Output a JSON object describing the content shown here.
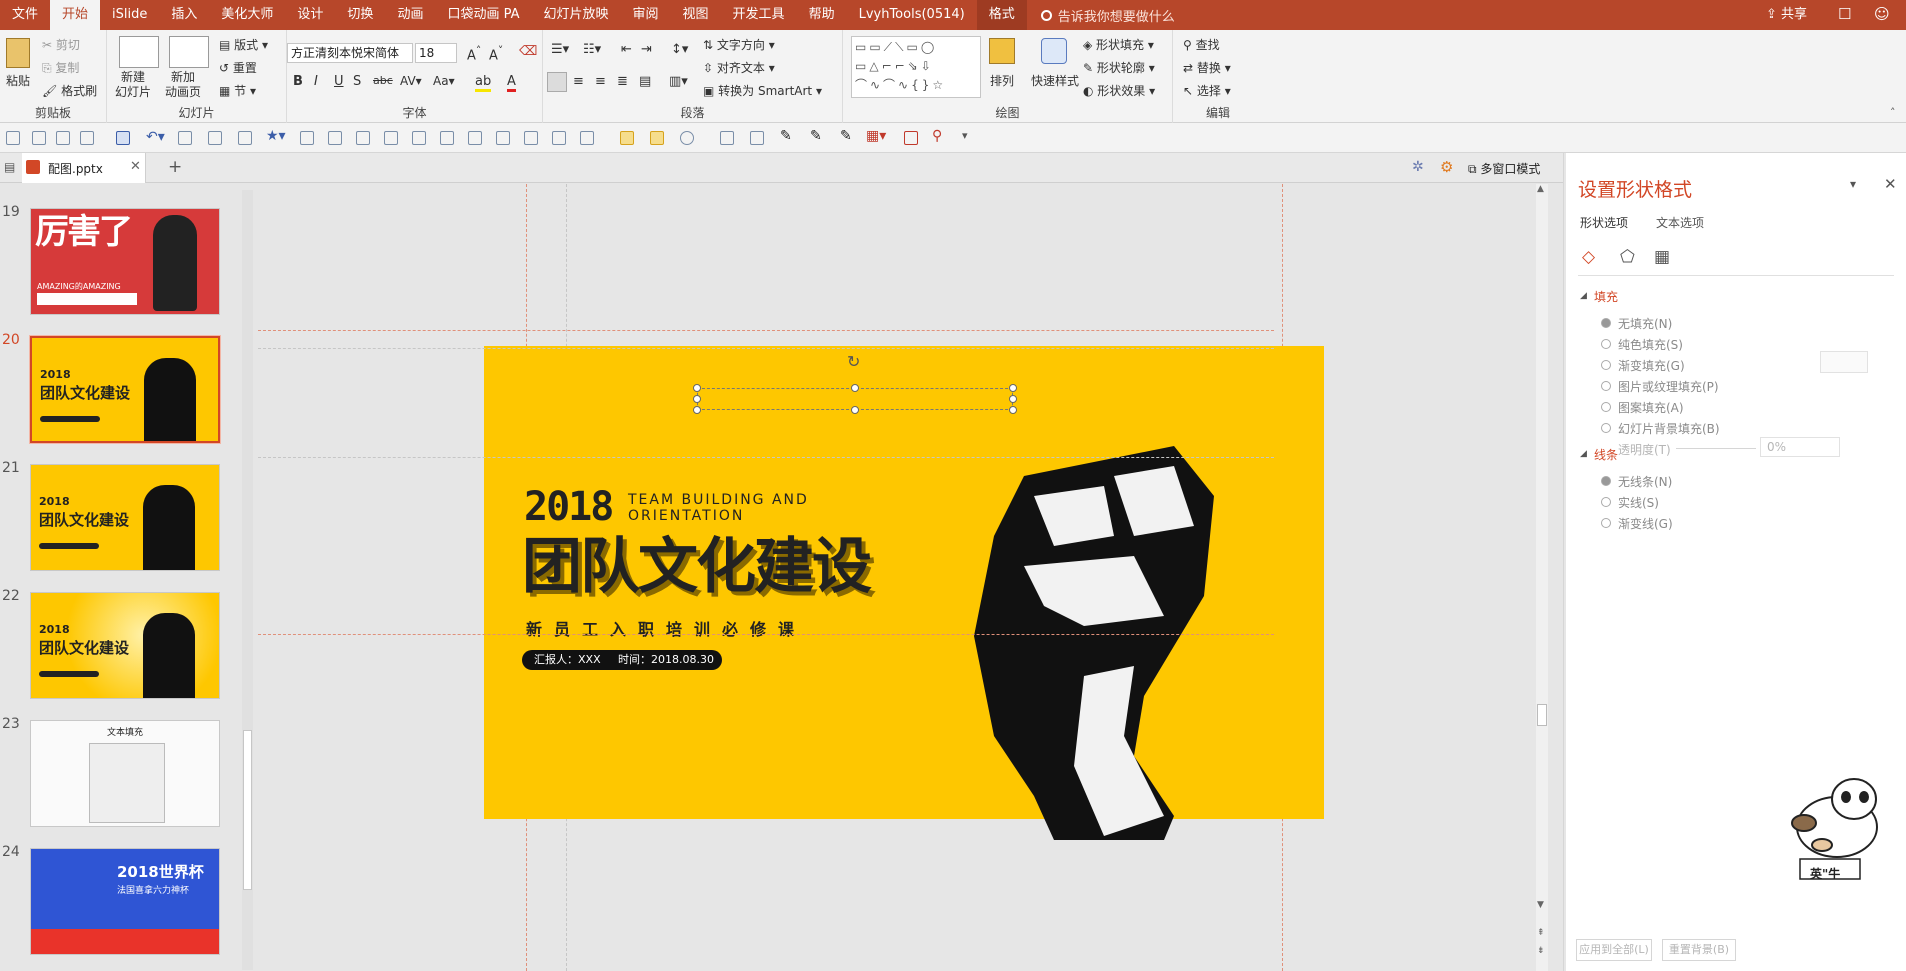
{
  "menubar": {
    "tabs": [
      "文件",
      "开始",
      "iSlide",
      "插入",
      "美化大师",
      "设计",
      "切换",
      "动画",
      "口袋动画 PA",
      "幻灯片放映",
      "审阅",
      "视图",
      "开发工具",
      "帮助",
      "LvyhTools(0514)",
      "格式"
    ],
    "search_placeholder": "告诉我你想要做什么",
    "share": "共享"
  },
  "ribbon": {
    "clipboard": {
      "paste": "粘贴",
      "cut": "剪切",
      "copy": "复制",
      "format_painter": "格式刷",
      "label": "剪贴板"
    },
    "slides": {
      "new_slide": "新建\n幻灯片",
      "new_anim_page": "新加\n动画页",
      "layout": "版式",
      "reset": "重置",
      "section": "节",
      "label": "幻灯片"
    },
    "font": {
      "family": "方正清刻本悦宋简体",
      "size": "18",
      "label": "字体"
    },
    "paragraph": {
      "text_direction": "文字方向",
      "align_text": "对齐文本",
      "smartart": "转换为 SmartArt",
      "label": "段落"
    },
    "drawing": {
      "arrange": "排列",
      "quick_styles": "快速样式",
      "shape_fill": "形状填充",
      "shape_outline": "形状轮廓",
      "shape_effects": "形状效果",
      "label": "绘图"
    },
    "editing": {
      "find": "查找",
      "replace": "替换",
      "select": "选择",
      "label": "编辑"
    }
  },
  "tabbar": {
    "file_tab": "配图.pptx",
    "multi_window": "多窗口模式"
  },
  "thumbnails": [
    {
      "num": "19",
      "title": "厉害了",
      "subtitle": "AMAZING的AMAZING"
    },
    {
      "num": "20",
      "title": "团队文化建设",
      "subtitle": "2018"
    },
    {
      "num": "21",
      "title": "团队文化建设",
      "subtitle": "2018"
    },
    {
      "num": "22",
      "title": "团队文化建设",
      "subtitle": "2018"
    },
    {
      "num": "23",
      "title": "文本填充",
      "subtitle": ""
    },
    {
      "num": "24",
      "title": "2018世界杯",
      "subtitle": "法国喜拿六力神杯"
    }
  ],
  "slide": {
    "year": "2018",
    "en_line1": "TEAM BUILDING AND",
    "en_line2": "ORIENTATION",
    "title": "团队文化建设",
    "subtitle": "新员工入职培训必修课",
    "presenter": "汇报人：XXX",
    "date": "时间：2018.08.30"
  },
  "pane": {
    "title": "设置形状格式",
    "tab_shape": "形状选项",
    "tab_text": "文本选项",
    "fill_header": "填充",
    "fill_options": [
      "无填充(N)",
      "纯色填充(S)",
      "渐变填充(G)",
      "图片或纹理填充(P)",
      "图案填充(A)",
      "幻灯片背景填充(B)"
    ],
    "transparency_label": "透明度(T)",
    "transparency_value": "0%",
    "line_header": "线条",
    "line_options": [
      "无线条(N)",
      "实线(S)",
      "渐变线(G)"
    ],
    "apply_all": "应用到全部(L)",
    "reset_bg": "重置背景(B)",
    "sticker_text": "英\"牛"
  },
  "colors": {
    "accent": "#b7472a",
    "slide_bg": "#fec700",
    "pane_title": "#d24726"
  }
}
